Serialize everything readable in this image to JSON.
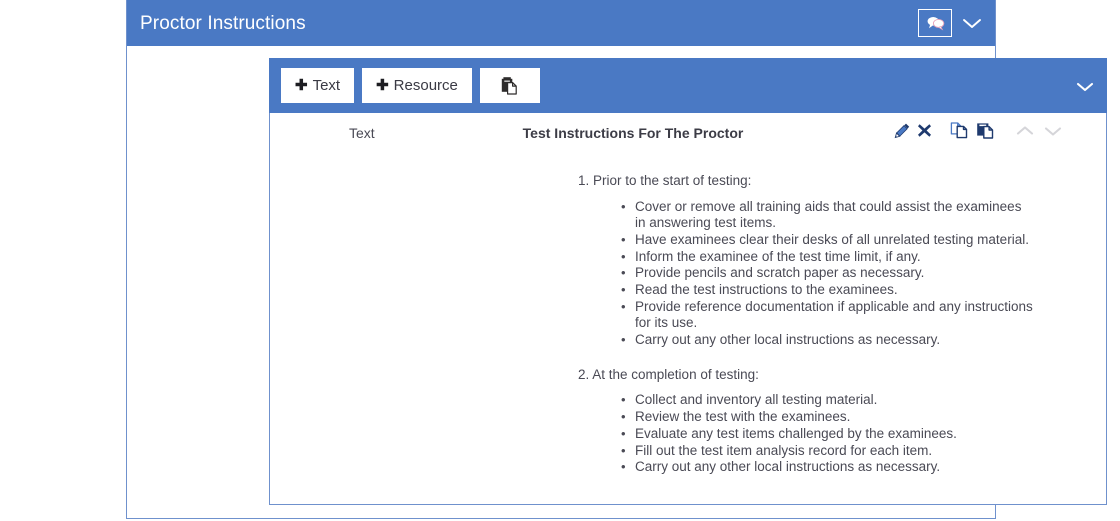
{
  "colors": {
    "header_blue": "#4a79c4",
    "panel_border": "#6f91cd",
    "body_text": "#4a4a55",
    "icon_dark_blue": "#1f3a6e",
    "icon_light_blue": "#4a79c4",
    "chevron_gray": "#d5d5d9"
  },
  "header": {
    "title": "Proctor Instructions",
    "chat_icon": "chat-bubble-icon",
    "collapse_icon": "chevron-down-icon"
  },
  "toolbar": {
    "buttons": [
      {
        "plus": "✚",
        "label": "Text",
        "name": "add-text-button"
      },
      {
        "plus": "✚",
        "label": "Resource",
        "name": "add-resource-button"
      }
    ],
    "paste_button": {
      "label": "",
      "icon": "paste-icon",
      "name": "paste-button"
    },
    "collapse_icon": "chevron-down-icon"
  },
  "content_row": {
    "type_label": "Text",
    "title": "Test Instructions For The Proctor",
    "actions": [
      {
        "name": "edit-icon",
        "label": "Edit"
      },
      {
        "name": "delete-icon",
        "label": "Delete"
      },
      {
        "name": "copy-icon",
        "label": "Copy"
      },
      {
        "name": "paste-icon",
        "label": "Paste"
      },
      {
        "name": "move-up-icon",
        "label": "Move up"
      },
      {
        "name": "move-down-icon",
        "label": "Move down"
      }
    ]
  },
  "document": {
    "sections": [
      {
        "heading": "1. Prior to the start of testing:",
        "items": [
          "Cover or remove all training aids that could assist the examinees in answering test items.",
          "Have examinees clear their desks of all unrelated testing material.",
          "Inform the examinee of the test time limit, if any.",
          "Provide pencils and scratch paper as necessary.",
          "Read the test instructions to the examinees.",
          "Provide reference documentation if applicable and any instructions for its use.",
          "Carry out any other local instructions as necessary."
        ]
      },
      {
        "heading": "2. At the completion of testing:",
        "items": [
          "Collect and inventory all testing material.",
          "Review the test with the examinees.",
          "Evaluate any test items challenged by the examinees.",
          "Fill out the test item analysis record for each item.",
          "Carry out any other local instructions as necessary."
        ]
      }
    ]
  }
}
